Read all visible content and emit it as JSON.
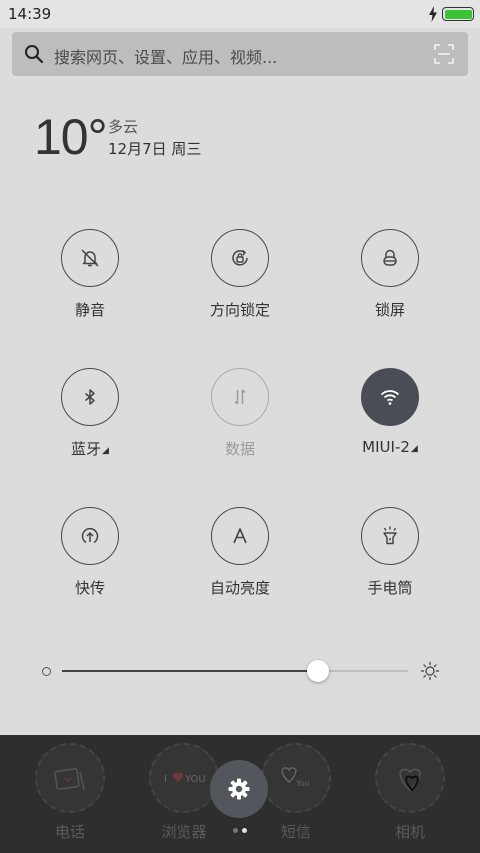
{
  "status_bar": {
    "time": "14:39",
    "battery_color": "#3cc235"
  },
  "search": {
    "placeholder": "搜索网页、设置、应用、视频..."
  },
  "weather": {
    "temperature": "10°",
    "condition": "多云",
    "date": "12月7日 周三"
  },
  "toggles": [
    {
      "label": "静音",
      "icon": "bell-off-icon",
      "state": "off"
    },
    {
      "label": "方向锁定",
      "icon": "rotation-lock-icon",
      "state": "off"
    },
    {
      "label": "锁屏",
      "icon": "lock-icon",
      "state": "off"
    },
    {
      "label": "蓝牙",
      "icon": "bluetooth-icon",
      "state": "off",
      "has_arrow": true
    },
    {
      "label": "数据",
      "icon": "mobile-data-icon",
      "state": "disabled"
    },
    {
      "label": "MIUI-2",
      "icon": "wifi-icon",
      "state": "on",
      "has_arrow": true
    },
    {
      "label": "快传",
      "icon": "quick-share-icon",
      "state": "off"
    },
    {
      "label": "自动亮度",
      "icon": "auto-brightness-icon",
      "state": "off"
    },
    {
      "label": "手电筒",
      "icon": "flashlight-icon",
      "state": "off"
    }
  ],
  "brightness": {
    "level": 0.74
  },
  "dock": {
    "apps": [
      {
        "label": "电话",
        "icon": "phone-app-icon"
      },
      {
        "label": "浏览器",
        "icon": "browser-app-icon"
      },
      {
        "label": "短信",
        "icon": "sms-app-icon"
      },
      {
        "label": "相机",
        "icon": "camera-app-icon"
      }
    ],
    "settings_icon": "gear-icon",
    "page_count": 2,
    "current_page": 2
  },
  "colors": {
    "background": "#dcdcdc",
    "active_toggle": "#4a4c56",
    "dock": "#2e2e2e"
  }
}
